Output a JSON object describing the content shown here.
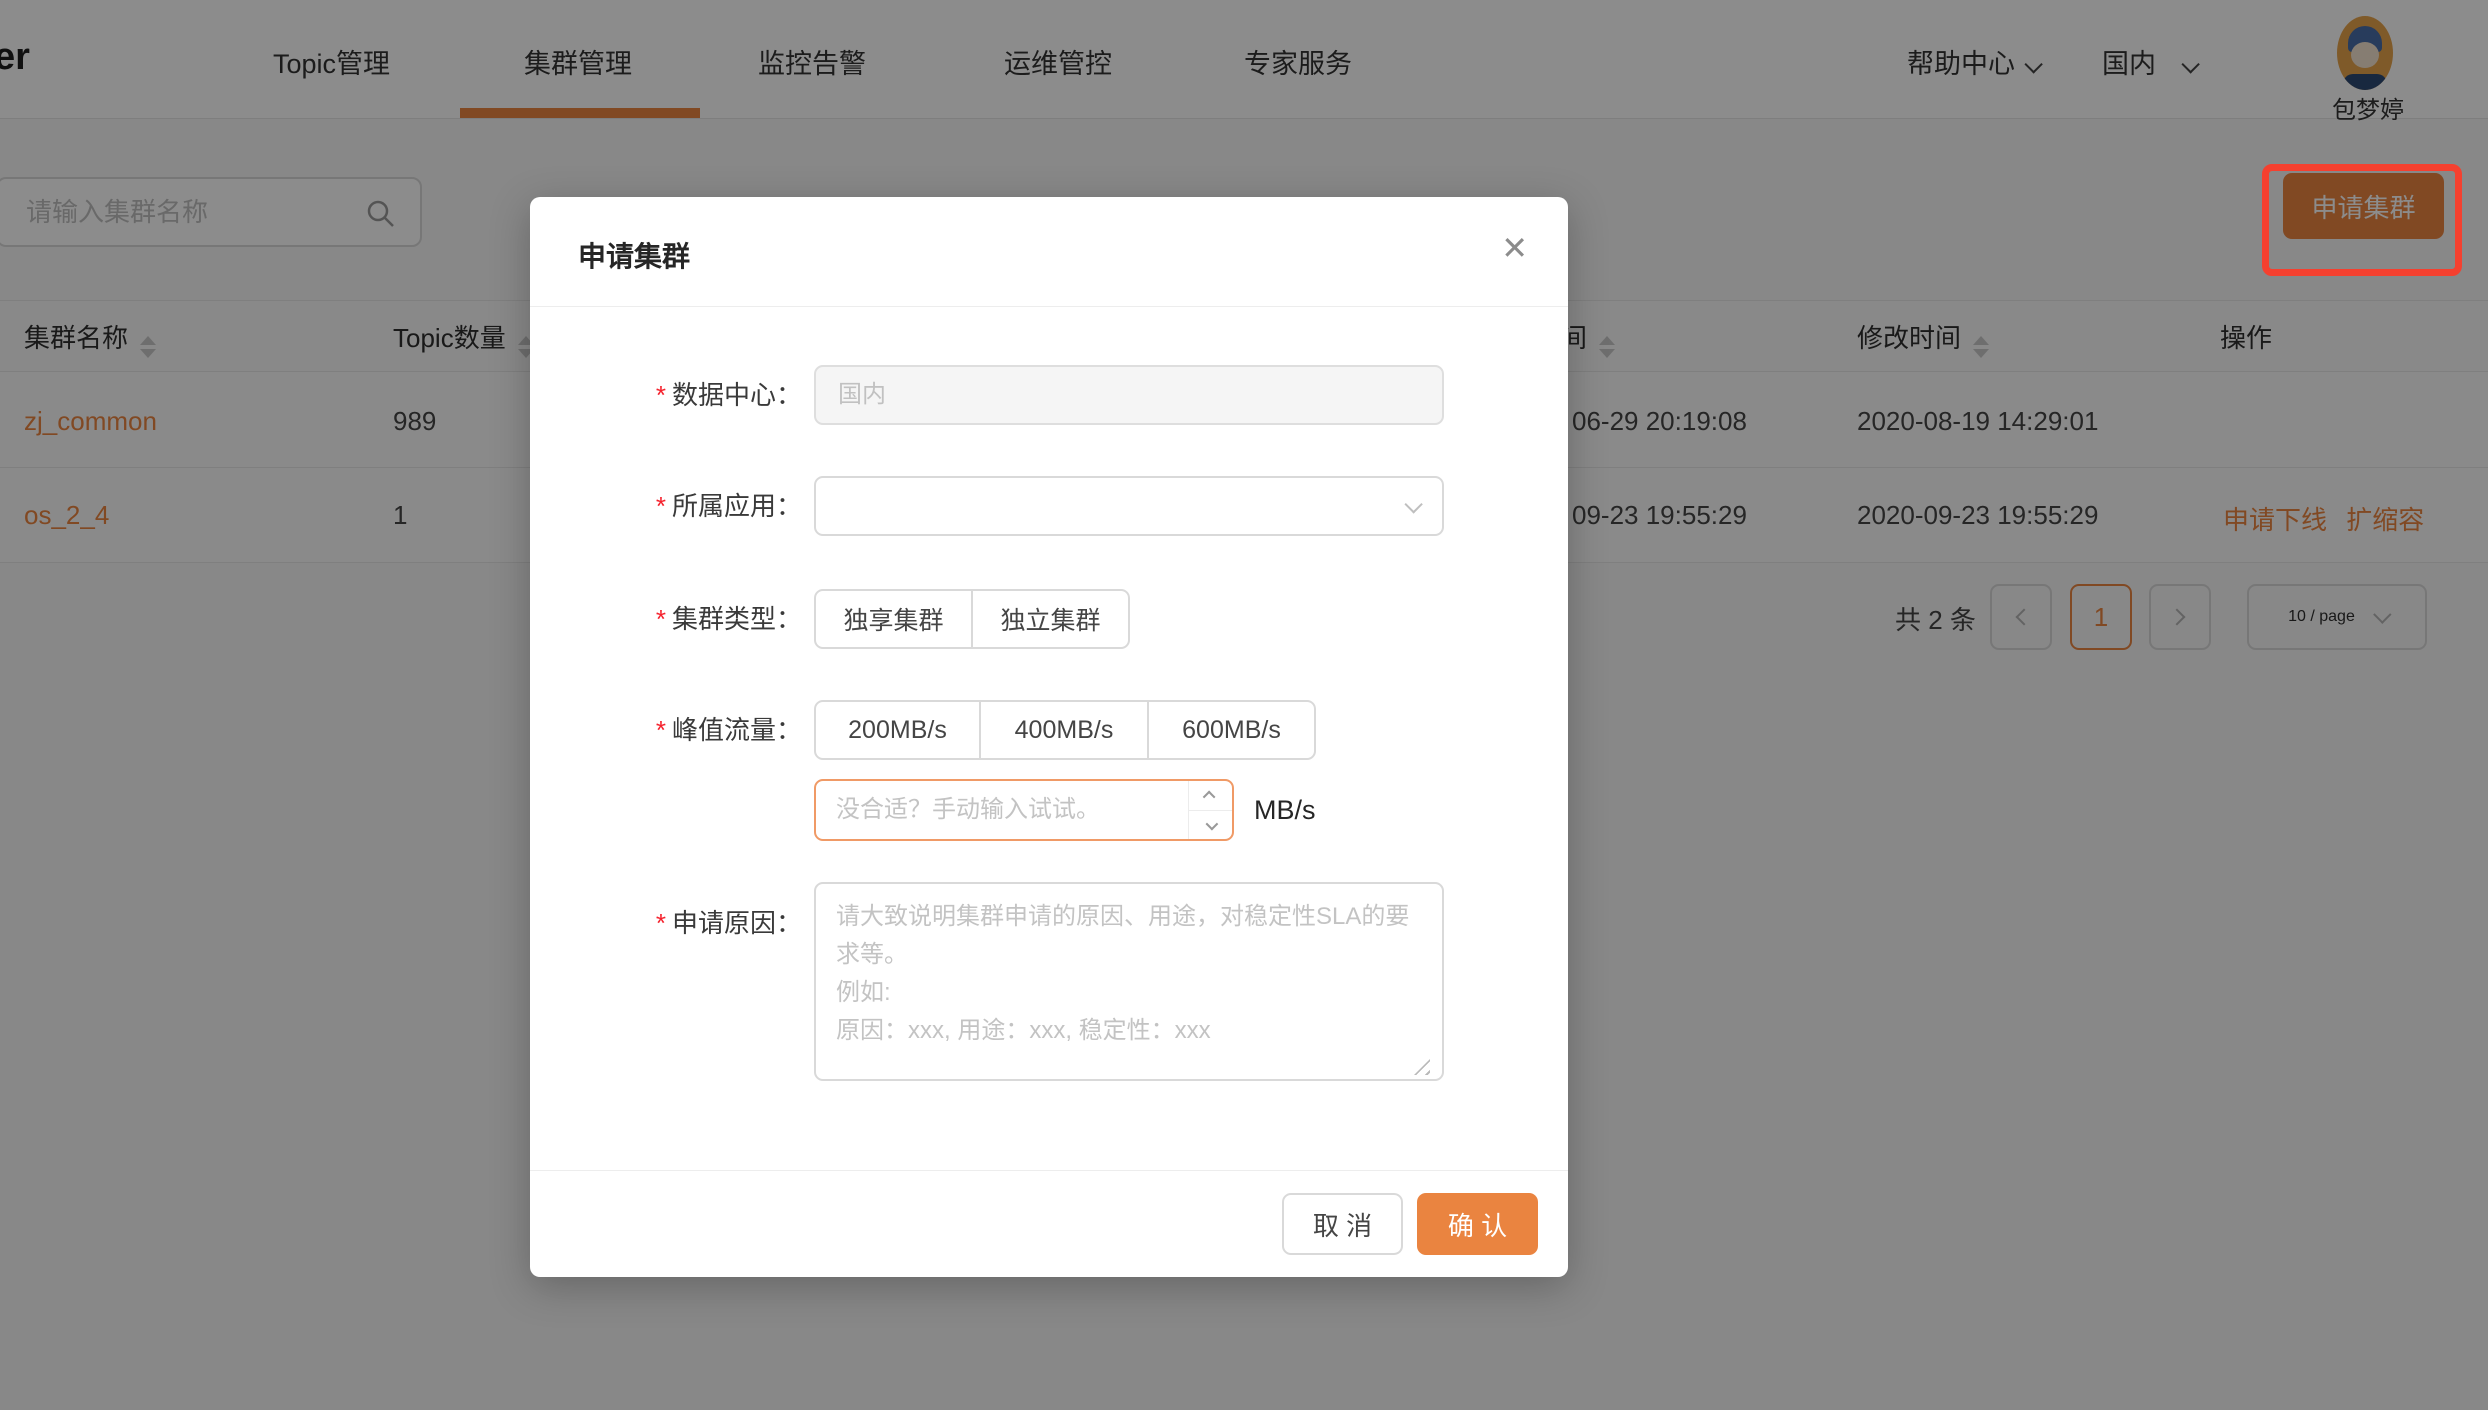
{
  "colors": {
    "accent": "#EC8540",
    "annotation": "#F5402F"
  },
  "header": {
    "logo": "er",
    "tabs": [
      {
        "label": "Topic管理",
        "active": false
      },
      {
        "label": "集群管理",
        "active": true
      },
      {
        "label": "监控告警",
        "active": false
      },
      {
        "label": "运维管控",
        "active": false
      },
      {
        "label": "专家服务",
        "active": false
      }
    ],
    "help": "帮助中心",
    "region": "国内",
    "user": "包梦婷"
  },
  "toolbar": {
    "search_placeholder": "请输入集群名称",
    "apply_button": "申请集群"
  },
  "table": {
    "col_name": "集群名称",
    "col_topics": "Topic数量",
    "col_time1": "间",
    "col_time2": "修改时间",
    "col_ops": "操作",
    "rows": [
      {
        "name": "zj_common",
        "topics": "989",
        "time1": "06-29 20:19:08",
        "time2": "2020-08-19 14:29:01"
      },
      {
        "name": "os_2_4",
        "topics": "1",
        "time1": "09-23 19:55:29",
        "time2": "2020-09-23 19:55:29",
        "op1": "申请下线",
        "op2": "扩缩容"
      }
    ]
  },
  "pagination": {
    "total": "共 2 条",
    "page": "1",
    "size": "10 / page"
  },
  "modal": {
    "title": "申请集群",
    "close": "✕",
    "data_center_label": "数据中心：",
    "data_center_value": "国内",
    "app_label": "所属应用：",
    "type_label": "集群类型：",
    "type_opt1": "独享集群",
    "type_opt2": "独立集群",
    "traffic_label": "峰值流量：",
    "traffic_opt1": "200MB/s",
    "traffic_opt2": "400MB/s",
    "traffic_opt3": "600MB/s",
    "traffic_placeholder": "没合适？手动输入试试。",
    "traffic_unit": "MB/s",
    "reason_label": "申请原因：",
    "reason_placeholder": "请大致说明集群申请的原因、用途，对稳定性SLA的要求等。\n例如:\n原因：xxx, 用途：xxx, 稳定性：xxx",
    "cancel": "取 消",
    "confirm": "确 认"
  }
}
